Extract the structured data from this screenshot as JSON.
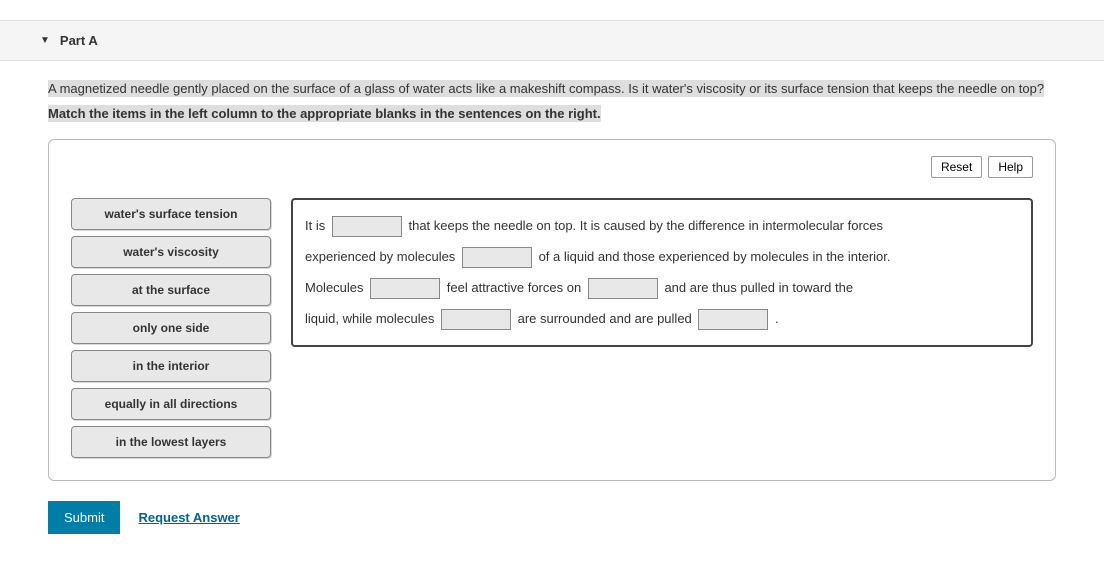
{
  "part": {
    "label": "Part A"
  },
  "question": "A magnetized needle gently placed on the surface of a glass of water acts like a makeshift compass. Is it water's viscosity or its surface tension that keeps the needle on top?",
  "instruction": "Match the items in the left column to the appropriate blanks in the sentences on the right.",
  "buttons": {
    "reset": "Reset",
    "help": "Help",
    "submit": "Submit",
    "request": "Request Answer"
  },
  "dragItems": [
    "water's surface tension",
    "water's viscosity",
    "at the surface",
    "only one side",
    "in the interior",
    "equally in all directions",
    "in the lowest layers"
  ],
  "sentence": {
    "s1a": "It is",
    "s1b": "that keeps the needle on top. It is caused by the difference in intermolecular forces",
    "s2a": "experienced by molecules",
    "s2b": "of a liquid and those experienced by molecules in the interior.",
    "s3a": "Molecules",
    "s3b": "feel attractive forces on",
    "s3c": "and are thus pulled in toward the",
    "s4a": "liquid, while molecules",
    "s4b": "are surrounded and are pulled",
    "s4c": "."
  }
}
